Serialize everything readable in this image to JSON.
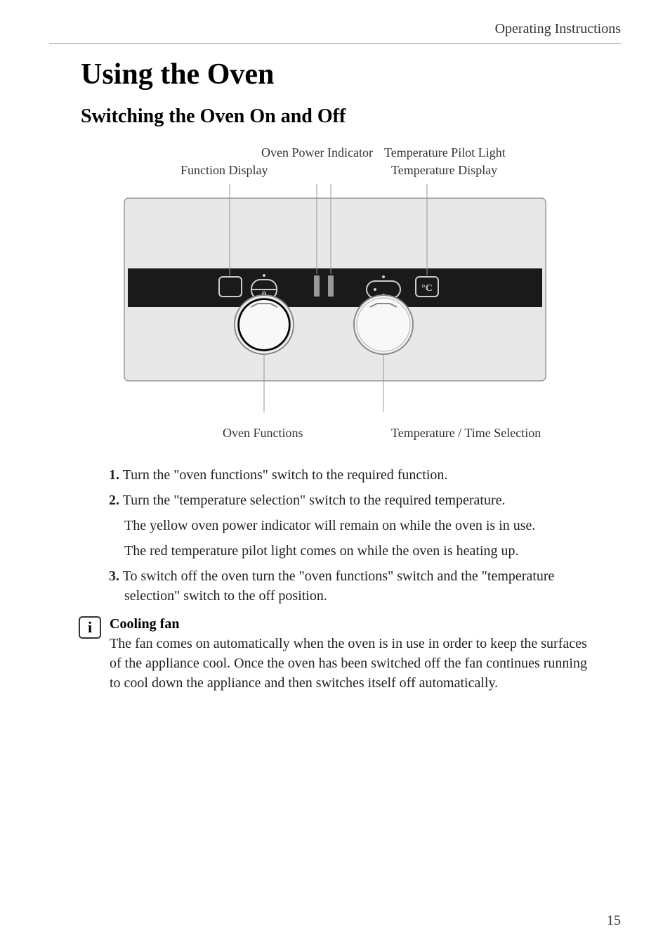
{
  "header": "Operating Instructions",
  "main_title": "Using the Oven",
  "sub_title": "Switching the Oven On and Off",
  "diagram": {
    "labels": {
      "function_display": "Function Display",
      "oven_power_indicator": "Oven Power Indicator",
      "temperature_pilot_light": "Temperature Pilot Light",
      "temperature_display": "Temperature Display",
      "oven_functions": "Oven Functions",
      "temperature_time_selection": "Temperature / Time Selection"
    }
  },
  "instructions": [
    {
      "num": "1.",
      "text": "Turn the \"oven functions\" switch to the required function."
    },
    {
      "num": "2.",
      "text": "Turn the \"temperature selection\" switch to the required temperature.",
      "subs": [
        "The yellow oven power indicator will remain on while the oven is in use.",
        "The red temperature pilot light comes on while the oven is heating up."
      ]
    },
    {
      "num": "3.",
      "text": "To switch off the oven turn the \"oven functions\" switch and the \"temperature selection\" switch to the off position."
    }
  ],
  "info": {
    "icon": "i",
    "title": "Cooling fan",
    "text": "The fan comes on automatically when the oven is in use in order to keep the surfaces of the appliance cool. Once the oven has been switched off the fan continues running to cool down the appliance and then switches itself off automatically."
  },
  "page_number": "15"
}
